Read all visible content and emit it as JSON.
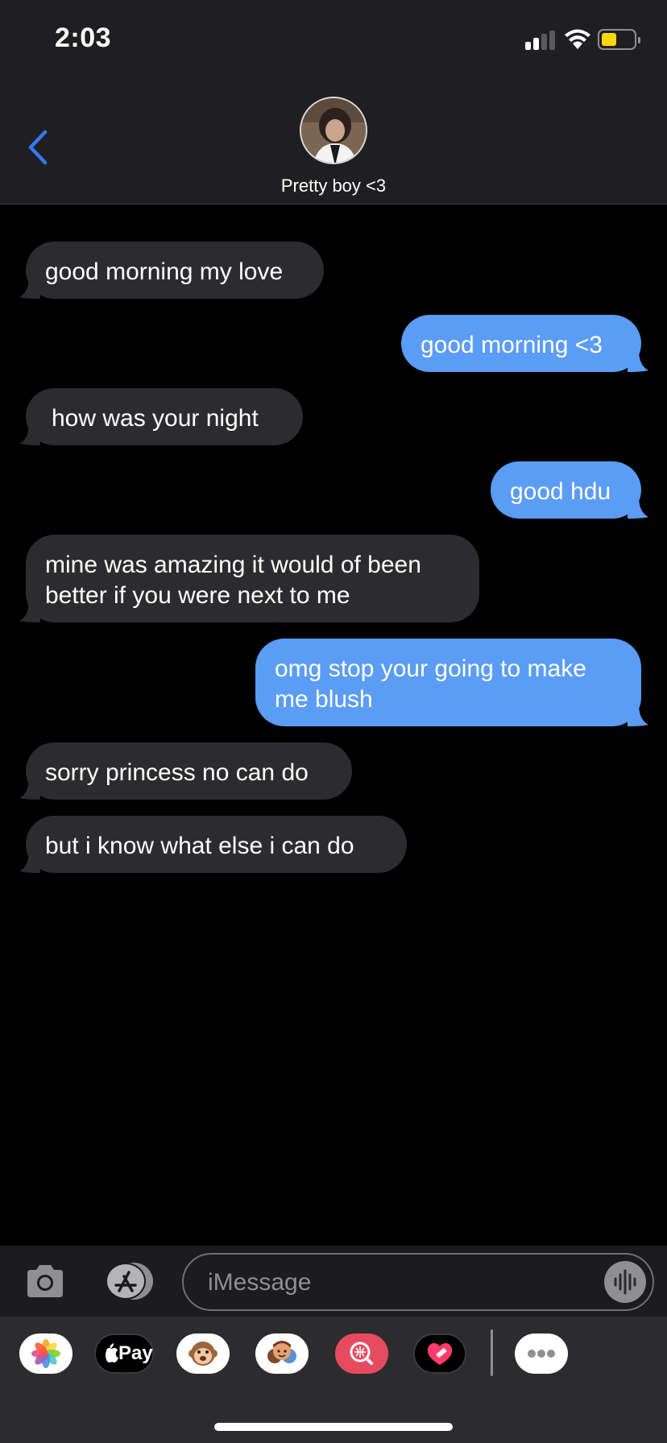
{
  "status_bar": {
    "time": "2:03"
  },
  "header": {
    "contact_name": "Pretty boy <3",
    "back_icon": "chevron-left-icon",
    "avatar_icon": "contact-avatar"
  },
  "messages": [
    {
      "direction": "in",
      "text": "good morning my love"
    },
    {
      "direction": "out",
      "text": "good morning <3"
    },
    {
      "direction": "in",
      "text": "how was your night"
    },
    {
      "direction": "out",
      "text": "good hdu"
    },
    {
      "direction": "in",
      "text": "mine was amazing it would of been better if you were next to me"
    },
    {
      "direction": "out",
      "text": "omg stop your going to make me blush"
    },
    {
      "direction": "in",
      "text": "sorry princess no can do"
    },
    {
      "direction": "in",
      "text": "but i know what else i can do"
    }
  ],
  "composer": {
    "placeholder": "iMessage",
    "camera_icon": "camera-icon",
    "apps_icon": "app-store-icon",
    "audio_icon": "waveform-icon"
  },
  "app_drawer": {
    "items": [
      "photos-icon",
      "apple-pay-icon",
      "animoji-icon",
      "memoji-icon",
      "image-search-icon",
      "heart-app-icon",
      "more-icon"
    ],
    "apple_pay_label": "Pay"
  },
  "colors": {
    "outgoing_bubble": "#5b9cf4",
    "incoming_bubble": "#2c2c2e",
    "accent": "#3478f6",
    "battery": "#ffd60a"
  }
}
